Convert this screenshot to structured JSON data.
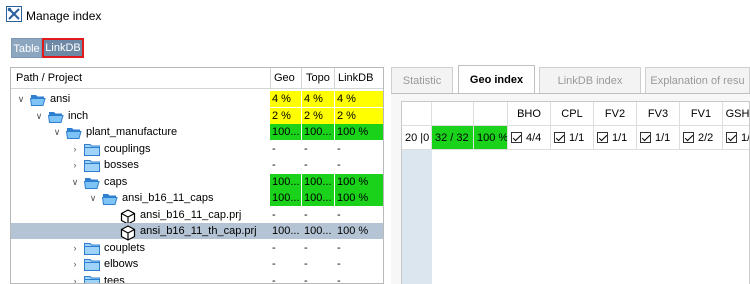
{
  "window": {
    "title": "Manage index",
    "icon": "tools-icon"
  },
  "view_toggle": {
    "table_label": "Table",
    "linkdb_label": "LinkDB"
  },
  "tree": {
    "columns": [
      "Path / Project",
      "Geo",
      "Topo",
      "LinkDB"
    ],
    "rows": [
      {
        "label": "ansi",
        "icon": "open-folder-icon",
        "expander": "expanded",
        "geo": "4 %",
        "topo": "4 %",
        "linkdb": "4 %",
        "status": "yellow"
      },
      {
        "label": "inch",
        "icon": "open-folder-icon",
        "expander": "expanded",
        "geo": "2 %",
        "topo": "2 %",
        "linkdb": "2 %",
        "status": "yellow"
      },
      {
        "label": "plant_manufacture",
        "icon": "open-folder-icon",
        "expander": "expanded",
        "geo": "100...",
        "topo": "100...",
        "linkdb": "100 %",
        "status": "green"
      },
      {
        "label": "couplings",
        "icon": "folder-icon",
        "expander": "collapsed",
        "geo": "-",
        "topo": "-",
        "linkdb": "-",
        "status": "none"
      },
      {
        "label": "bosses",
        "icon": "folder-icon",
        "expander": "collapsed",
        "geo": "-",
        "topo": "-",
        "linkdb": "-",
        "status": "none"
      },
      {
        "label": "caps",
        "icon": "open-folder-icon",
        "expander": "expanded",
        "geo": "100...",
        "topo": "100...",
        "linkdb": "100 %",
        "status": "green"
      },
      {
        "label": "ansi_b16_11_caps",
        "icon": "open-folder-icon",
        "expander": "expanded",
        "geo": "100...",
        "topo": "100...",
        "linkdb": "100 %",
        "status": "green"
      },
      {
        "label": "ansi_b16_11_cap.prj",
        "icon": "cube-icon",
        "expander": "none",
        "geo": "-",
        "topo": "-",
        "linkdb": "-",
        "status": "none"
      },
      {
        "label": "ansi_b16_11_th_cap.prj",
        "icon": "cube-icon",
        "expander": "none",
        "geo": "100...",
        "topo": "100...",
        "linkdb": "100 %",
        "status": "selected"
      },
      {
        "label": "couplets",
        "icon": "folder-icon",
        "expander": "collapsed",
        "geo": "-",
        "topo": "-",
        "linkdb": "-",
        "status": "none"
      },
      {
        "label": "elbows",
        "icon": "folder-icon",
        "expander": "collapsed",
        "geo": "-",
        "topo": "-",
        "linkdb": "-",
        "status": "none"
      },
      {
        "label": "tees",
        "icon": "folder-icon",
        "expander": "collapsed",
        "geo": "-",
        "topo": "-",
        "linkdb": "-",
        "status": "none"
      }
    ]
  },
  "tabs": [
    {
      "label": "Statistic",
      "active": false
    },
    {
      "label": "Geo index",
      "active": true
    },
    {
      "label": "LinkDB index",
      "active": false
    },
    {
      "label": "Explanation of resu",
      "active": false
    }
  ],
  "geo_table": {
    "headers": [
      "",
      "",
      "",
      "BHO",
      "CPL",
      "FV2",
      "FV3",
      "FV1",
      "GSH"
    ],
    "row": {
      "id": "20 |0",
      "ratio": "32 / 32",
      "percent": "100 %",
      "checks": [
        "4/4",
        "1/1",
        "1/1",
        "1/1",
        "2/2",
        "1/"
      ]
    }
  },
  "colors": {
    "yellow": "#ffff00",
    "green": "#19d219",
    "selected": "#b4c4d4",
    "highlight_border": "#e01b1b"
  }
}
